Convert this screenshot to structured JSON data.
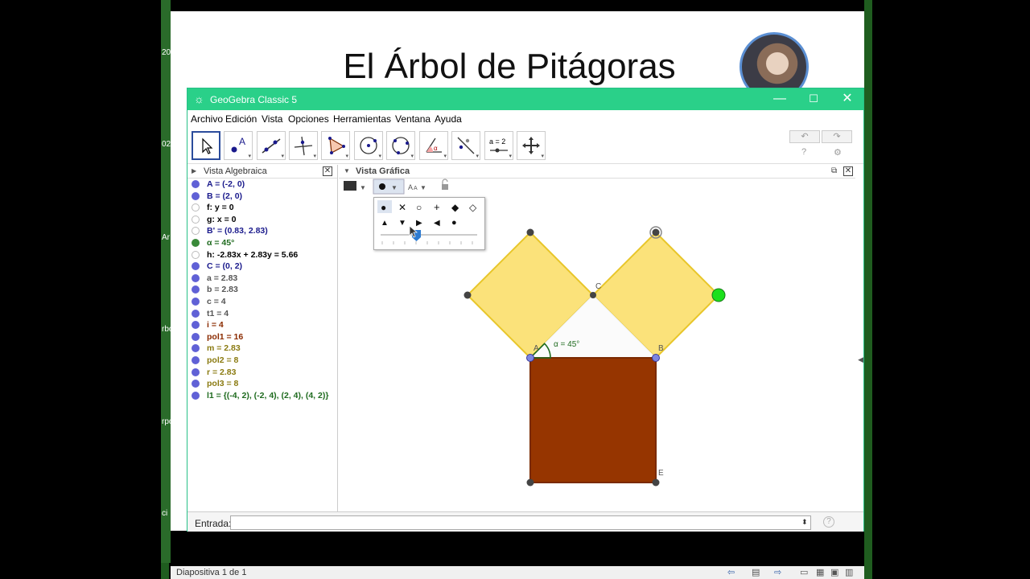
{
  "slide": {
    "title": "El Árbol de Pitágoras",
    "left_strip": [
      "20",
      "02",
      "Ar",
      "rbo",
      "rpo",
      "ci"
    ]
  },
  "window": {
    "app_title": "GeoGebra Classic 5",
    "controls": {
      "minimize": "—",
      "maximize": "☐",
      "close": "✕"
    }
  },
  "menu": [
    "Archivo",
    "Edición",
    "Vista",
    "Opciones",
    "Herramientas",
    "Ventana",
    "Ayuda"
  ],
  "toolbar": {
    "tools": [
      "move-tool",
      "point-tool",
      "line-tool",
      "perpendicular-tool",
      "polygon-tool",
      "circle-tool",
      "conic-tool",
      "angle-tool",
      "reflect-tool",
      "slider-tool",
      "move-view-tool"
    ],
    "slider_label": "a = 2",
    "point_label": "A",
    "undo": "↶",
    "redo": "↷",
    "help": "?",
    "settings": "⚙"
  },
  "algebra": {
    "header": "Vista Algebraica",
    "items": [
      {
        "text": "A = (-2, 0)",
        "dot": "filled",
        "color": "#1a1a8c"
      },
      {
        "text": "B = (2, 0)",
        "dot": "filled",
        "color": "#1a1a8c"
      },
      {
        "text": "f: y = 0",
        "dot": "empty",
        "color": "#000000"
      },
      {
        "text": "g: x = 0",
        "dot": "empty",
        "color": "#000000"
      },
      {
        "text": "B' = (0.83, 2.83)",
        "dot": "empty",
        "color": "#1a1a8c"
      },
      {
        "text": "α = 45°",
        "dot": "green",
        "color": "#1f6b1f"
      },
      {
        "text": "h: -2.83x + 2.83y = 5.66",
        "dot": "empty",
        "color": "#000000"
      },
      {
        "text": "C = (0, 2)",
        "dot": "filled",
        "color": "#1a1a8c"
      },
      {
        "text": "a = 2.83",
        "dot": "filled",
        "color": "#555555"
      },
      {
        "text": "b = 2.83",
        "dot": "filled",
        "color": "#555555"
      },
      {
        "text": "c = 4",
        "dot": "filled",
        "color": "#555555"
      },
      {
        "text": "t1 = 4",
        "dot": "filled",
        "color": "#555555"
      },
      {
        "text": "i = 4",
        "dot": "filled",
        "color": "#8b2b00"
      },
      {
        "text": "pol1 = 16",
        "dot": "filled",
        "color": "#8b2b00"
      },
      {
        "text": "m = 2.83",
        "dot": "filled",
        "color": "#8a7a10"
      },
      {
        "text": "pol2 = 8",
        "dot": "filled",
        "color": "#8a7a10"
      },
      {
        "text": "r = 2.83",
        "dot": "filled",
        "color": "#8a7a10"
      },
      {
        "text": "pol3 = 8",
        "dot": "filled",
        "color": "#8a7a10"
      },
      {
        "text": "l1 = {(-4, 2), (-2, 4), (2, 4), (4, 2)}",
        "dot": "filled",
        "color": "#1f6b1f"
      }
    ]
  },
  "graphics": {
    "header": "Vista Gráfica",
    "labels": {
      "C": "C",
      "A": "A",
      "B": "B",
      "E": "E",
      "angle": "α = 45°"
    },
    "point_styles": [
      "●",
      "✕",
      "○",
      "+",
      "◆",
      "◇",
      "▲",
      "▼",
      "▶",
      "◀",
      "●"
    ],
    "colors": {
      "yellow_fill": "#fbe27a",
      "yellow_stroke": "#e8c62a",
      "brown_fill": "#963500",
      "brown_stroke": "#7a2a00",
      "green_point": "#1ce01c"
    }
  },
  "inputbar": {
    "label": "Entrada:",
    "value": "",
    "help": "?"
  },
  "statusbar": {
    "text": "Diapositiva 1 de 1"
  }
}
